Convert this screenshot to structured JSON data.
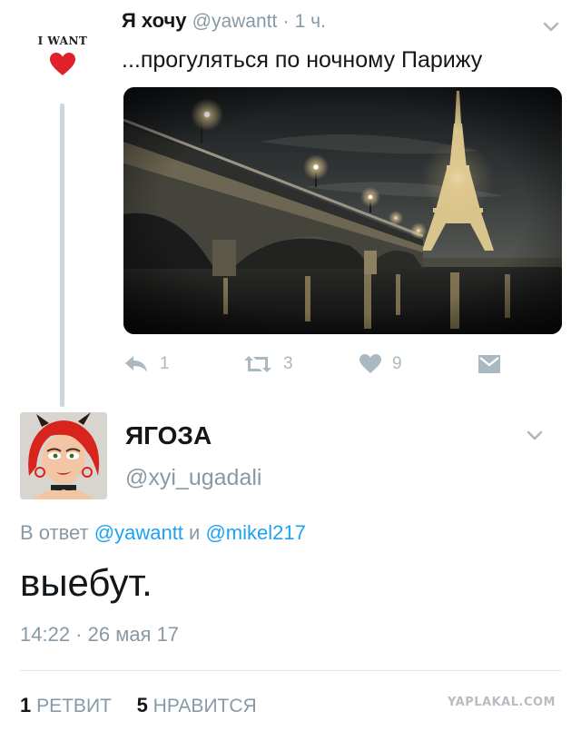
{
  "top_tweet": {
    "avatar_text": "I WANT",
    "author_name": "Я хочу",
    "handle": "@yawantt",
    "separator": "·",
    "time": "1 ч.",
    "text": "...прогуляться по ночному Парижу",
    "actions": {
      "reply_count": "1",
      "retweet_count": "3",
      "like_count": "9"
    }
  },
  "reply_tweet": {
    "author_name": "ЯГОЗА",
    "handle": "@xyi_ugadali",
    "reply_prefix": "В ответ",
    "reply_mention_1": "@yawantt",
    "reply_conj": "и",
    "reply_mention_2": "@mikel217",
    "text": "выебут.",
    "timestamp": "14:22 · 26 мая 17",
    "retweets_count": "1",
    "retweets_label": "РЕТВИТ",
    "likes_count": "5",
    "likes_label": "НРАВИТСЯ"
  },
  "watermark": "YAPLAKAL.COM",
  "colors": {
    "link": "#1da1f2",
    "muted": "#8899a6",
    "icon": "#aab8c2",
    "heart": "#e0202a"
  }
}
